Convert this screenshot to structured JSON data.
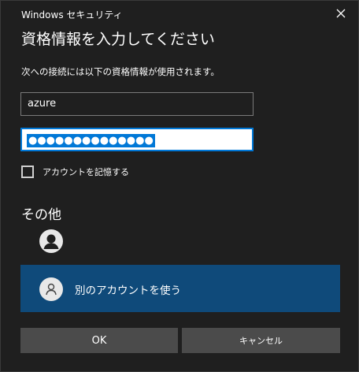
{
  "window": {
    "title": "Windows セキュリティ"
  },
  "dialog": {
    "heading": "資格情報を入力してください",
    "description": "次への接続には以下の資格情報が使用されます。"
  },
  "form": {
    "username_value": "azure",
    "password_value": "●●●●●●●●●●●●●●",
    "remember_label": "アカウントを記憶する",
    "remember_checked": false
  },
  "other": {
    "heading": "その他",
    "use_other_account_label": "別のアカウントを使う"
  },
  "buttons": {
    "ok_label": "OK",
    "cancel_label": "キャンセル"
  },
  "icons": {
    "close": "close-icon",
    "account": "user-icon",
    "other_account": "user-outline-icon"
  },
  "colors": {
    "background": "#1f1f1f",
    "accent": "#0078d7",
    "selected_account_bg": "#0f4a7a",
    "button_bg": "#4b4b4b"
  }
}
